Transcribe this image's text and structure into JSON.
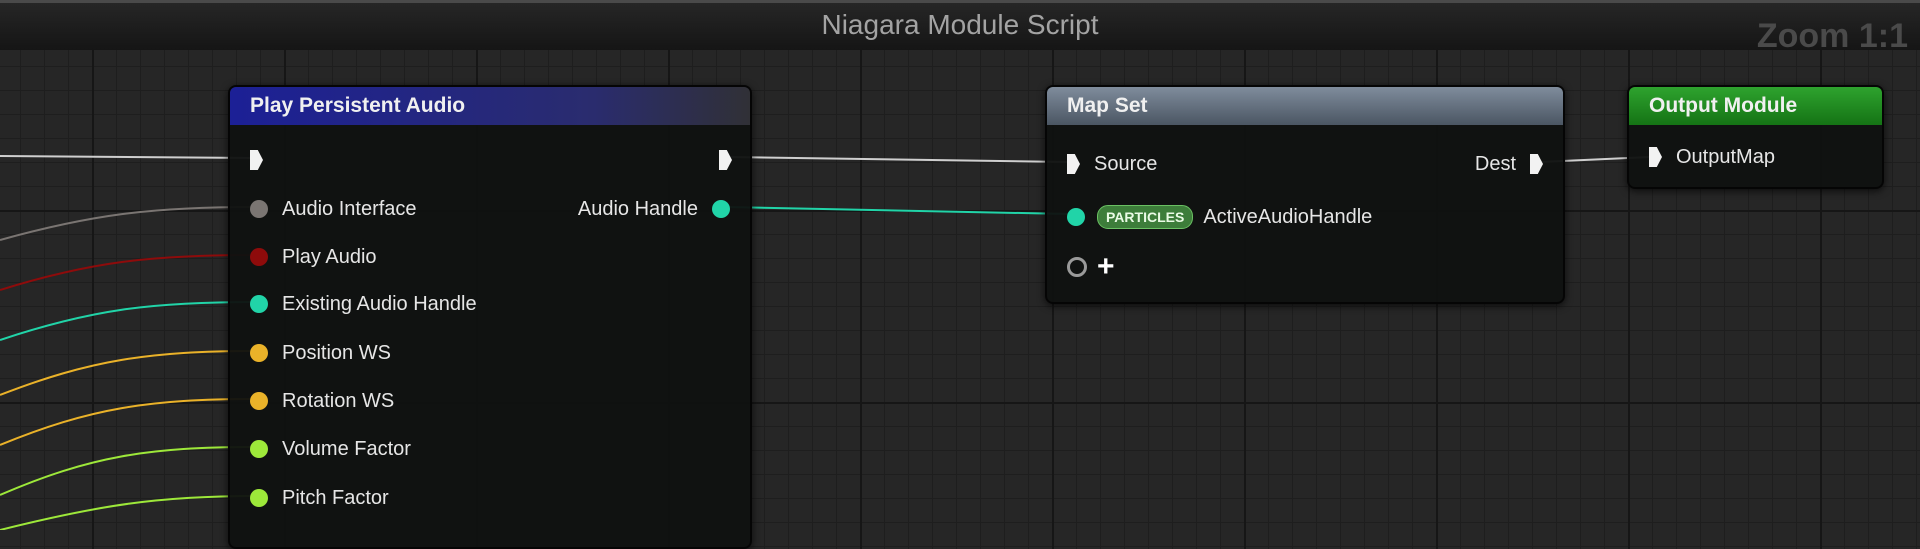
{
  "editor": {
    "title": "Niagara Module Script",
    "zoom_label": "Zoom 1:1"
  },
  "nodes": {
    "play_audio": {
      "title": "Play Persistent Audio",
      "header_color": "#20248f",
      "inputs": [
        {
          "label": "Audio Interface",
          "color": "#7a7572"
        },
        {
          "label": "Play Audio",
          "color": "#8e0b0b"
        },
        {
          "label": "Existing Audio Handle",
          "color": "#21d4a8"
        },
        {
          "label": "Position WS",
          "color": "#eab229"
        },
        {
          "label": "Rotation WS",
          "color": "#eab229"
        },
        {
          "label": "Volume Factor",
          "color": "#9de83a"
        },
        {
          "label": "Pitch Factor",
          "color": "#9de83a"
        }
      ],
      "outputs": [
        {
          "label": "Audio Handle",
          "color": "#21d4a8"
        }
      ]
    },
    "map_set": {
      "title": "Map Set",
      "header_color": "#5d6a7a",
      "source_label": "Source",
      "dest_label": "Dest",
      "param_badge": "PARTICLES",
      "param_label": "ActiveAudioHandle",
      "param_color": "#21d4a8"
    },
    "output_module": {
      "title": "Output Module",
      "header_color": "#1f8c1f",
      "pin_label": "OutputMap"
    }
  }
}
